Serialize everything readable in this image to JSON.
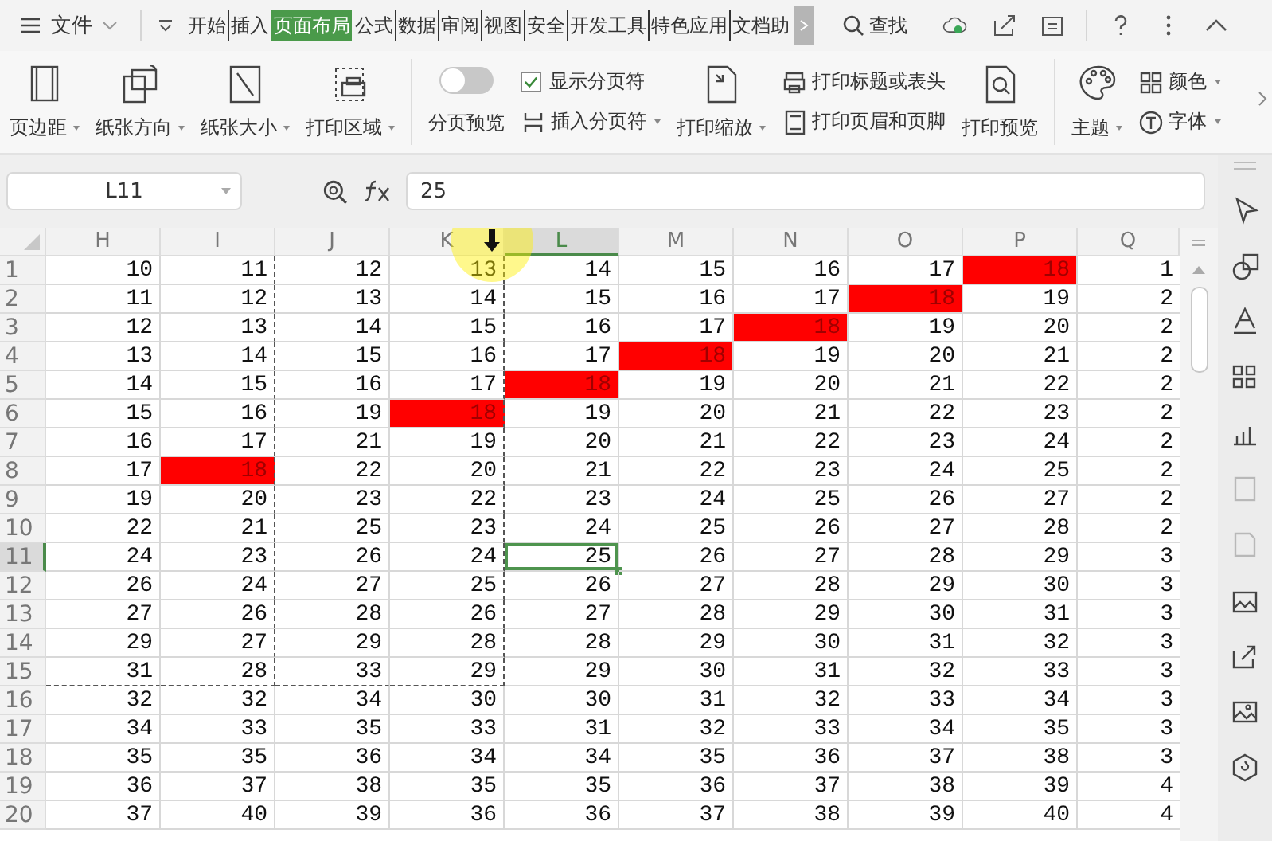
{
  "menu": {
    "file_label": "文件"
  },
  "tabs": [
    {
      "label": "开始",
      "selected": false
    },
    {
      "label": "插入",
      "selected": false
    },
    {
      "label": "页面布局",
      "selected": true
    },
    {
      "label": "公式",
      "selected": false
    },
    {
      "label": "数据",
      "selected": false
    },
    {
      "label": "审阅",
      "selected": false
    },
    {
      "label": "视图",
      "selected": false
    },
    {
      "label": "安全",
      "selected": false
    },
    {
      "label": "开发工具",
      "selected": false
    },
    {
      "label": "特色应用",
      "selected": false
    },
    {
      "label": "文档助",
      "selected": false
    }
  ],
  "search": {
    "label": "查找"
  },
  "ribbon": [
    {
      "kind": "big",
      "label": "页边距",
      "dropdown": true
    },
    {
      "kind": "big",
      "label": "纸张方向",
      "dropdown": true
    },
    {
      "kind": "big",
      "label": "纸张大小",
      "dropdown": true
    },
    {
      "kind": "big",
      "label": "打印区域",
      "dropdown": true
    },
    {
      "kind": "separator"
    },
    {
      "kind": "toggle",
      "label": "分页预览",
      "on": false
    },
    {
      "kind": "stack",
      "items": [
        {
          "kind": "check",
          "label": "显示分页符",
          "checked": true
        },
        {
          "kind": "small",
          "label": "插入分页符",
          "dropdown": true
        }
      ]
    },
    {
      "kind": "big",
      "label": "打印缩放",
      "dropdown": true
    },
    {
      "kind": "stack",
      "items": [
        {
          "kind": "small",
          "label": "打印标题或表头",
          "dropdown": false
        },
        {
          "kind": "small",
          "label": "打印页眉和页脚",
          "dropdown": false
        }
      ]
    },
    {
      "kind": "big",
      "label": "打印预览",
      "dropdown": false
    },
    {
      "kind": "separator"
    },
    {
      "kind": "big",
      "label": "主题",
      "dropdown": true
    },
    {
      "kind": "stack",
      "items": [
        {
          "kind": "small",
          "label": "颜色",
          "dropdown": true
        },
        {
          "kind": "small",
          "label": "字体",
          "dropdown": true
        }
      ]
    }
  ],
  "formula_bar": {
    "name_box": "L11",
    "formula": "25"
  },
  "grid": {
    "columns": [
      {
        "label": "H",
        "selected": false,
        "page_break": false
      },
      {
        "label": "I",
        "selected": false,
        "page_break": true
      },
      {
        "label": "J",
        "selected": false,
        "page_break": false
      },
      {
        "label": "K",
        "selected": false,
        "page_break": true
      },
      {
        "label": "L",
        "selected": true,
        "page_break": false
      },
      {
        "label": "M",
        "selected": false,
        "page_break": false
      },
      {
        "label": "N",
        "selected": false,
        "page_break": false
      },
      {
        "label": "O",
        "selected": false,
        "page_break": false
      },
      {
        "label": "P",
        "selected": false,
        "page_break": false
      },
      {
        "label": "Q",
        "selected": false,
        "page_break": false
      }
    ],
    "rows": [
      {
        "label": "1",
        "selected": false,
        "page_break": false,
        "cells": [
          {
            "value": "10",
            "highlighted": false,
            "selected": false
          },
          {
            "value": "11",
            "highlighted": false,
            "selected": false
          },
          {
            "value": "12",
            "highlighted": false,
            "selected": false
          },
          {
            "value": "13",
            "highlighted": false,
            "selected": false
          },
          {
            "value": "14",
            "highlighted": false,
            "selected": false
          },
          {
            "value": "15",
            "highlighted": false,
            "selected": false
          },
          {
            "value": "16",
            "highlighted": false,
            "selected": false
          },
          {
            "value": "17",
            "highlighted": false,
            "selected": false
          },
          {
            "value": "18",
            "highlighted": true,
            "selected": false
          },
          {
            "value": "1",
            "highlighted": false,
            "selected": false
          }
        ]
      },
      {
        "label": "2",
        "selected": false,
        "page_break": false,
        "cells": [
          {
            "value": "11",
            "highlighted": false,
            "selected": false
          },
          {
            "value": "12",
            "highlighted": false,
            "selected": false
          },
          {
            "value": "13",
            "highlighted": false,
            "selected": false
          },
          {
            "value": "14",
            "highlighted": false,
            "selected": false
          },
          {
            "value": "15",
            "highlighted": false,
            "selected": false
          },
          {
            "value": "16",
            "highlighted": false,
            "selected": false
          },
          {
            "value": "17",
            "highlighted": false,
            "selected": false
          },
          {
            "value": "18",
            "highlighted": true,
            "selected": false
          },
          {
            "value": "19",
            "highlighted": false,
            "selected": false
          },
          {
            "value": "2",
            "highlighted": false,
            "selected": false
          }
        ]
      },
      {
        "label": "3",
        "selected": false,
        "page_break": false,
        "cells": [
          {
            "value": "12",
            "highlighted": false,
            "selected": false
          },
          {
            "value": "13",
            "highlighted": false,
            "selected": false
          },
          {
            "value": "14",
            "highlighted": false,
            "selected": false
          },
          {
            "value": "15",
            "highlighted": false,
            "selected": false
          },
          {
            "value": "16",
            "highlighted": false,
            "selected": false
          },
          {
            "value": "17",
            "highlighted": false,
            "selected": false
          },
          {
            "value": "18",
            "highlighted": true,
            "selected": false
          },
          {
            "value": "19",
            "highlighted": false,
            "selected": false
          },
          {
            "value": "20",
            "highlighted": false,
            "selected": false
          },
          {
            "value": "2",
            "highlighted": false,
            "selected": false
          }
        ]
      },
      {
        "label": "4",
        "selected": false,
        "page_break": false,
        "cells": [
          {
            "value": "13",
            "highlighted": false,
            "selected": false
          },
          {
            "value": "14",
            "highlighted": false,
            "selected": false
          },
          {
            "value": "15",
            "highlighted": false,
            "selected": false
          },
          {
            "value": "16",
            "highlighted": false,
            "selected": false
          },
          {
            "value": "17",
            "highlighted": false,
            "selected": false
          },
          {
            "value": "18",
            "highlighted": true,
            "selected": false
          },
          {
            "value": "19",
            "highlighted": false,
            "selected": false
          },
          {
            "value": "20",
            "highlighted": false,
            "selected": false
          },
          {
            "value": "21",
            "highlighted": false,
            "selected": false
          },
          {
            "value": "2",
            "highlighted": false,
            "selected": false
          }
        ]
      },
      {
        "label": "5",
        "selected": false,
        "page_break": false,
        "cells": [
          {
            "value": "14",
            "highlighted": false,
            "selected": false
          },
          {
            "value": "15",
            "highlighted": false,
            "selected": false
          },
          {
            "value": "16",
            "highlighted": false,
            "selected": false
          },
          {
            "value": "17",
            "highlighted": false,
            "selected": false
          },
          {
            "value": "18",
            "highlighted": true,
            "selected": false
          },
          {
            "value": "19",
            "highlighted": false,
            "selected": false
          },
          {
            "value": "20",
            "highlighted": false,
            "selected": false
          },
          {
            "value": "21",
            "highlighted": false,
            "selected": false
          },
          {
            "value": "22",
            "highlighted": false,
            "selected": false
          },
          {
            "value": "2",
            "highlighted": false,
            "selected": false
          }
        ]
      },
      {
        "label": "6",
        "selected": false,
        "page_break": false,
        "cells": [
          {
            "value": "15",
            "highlighted": false,
            "selected": false
          },
          {
            "value": "16",
            "highlighted": false,
            "selected": false
          },
          {
            "value": "19",
            "highlighted": false,
            "selected": false
          },
          {
            "value": "18",
            "highlighted": true,
            "selected": false
          },
          {
            "value": "19",
            "highlighted": false,
            "selected": false
          },
          {
            "value": "20",
            "highlighted": false,
            "selected": false
          },
          {
            "value": "21",
            "highlighted": false,
            "selected": false
          },
          {
            "value": "22",
            "highlighted": false,
            "selected": false
          },
          {
            "value": "23",
            "highlighted": false,
            "selected": false
          },
          {
            "value": "2",
            "highlighted": false,
            "selected": false
          }
        ]
      },
      {
        "label": "7",
        "selected": false,
        "page_break": false,
        "cells": [
          {
            "value": "16",
            "highlighted": false,
            "selected": false
          },
          {
            "value": "17",
            "highlighted": false,
            "selected": false
          },
          {
            "value": "21",
            "highlighted": false,
            "selected": false
          },
          {
            "value": "19",
            "highlighted": false,
            "selected": false
          },
          {
            "value": "20",
            "highlighted": false,
            "selected": false
          },
          {
            "value": "21",
            "highlighted": false,
            "selected": false
          },
          {
            "value": "22",
            "highlighted": false,
            "selected": false
          },
          {
            "value": "23",
            "highlighted": false,
            "selected": false
          },
          {
            "value": "24",
            "highlighted": false,
            "selected": false
          },
          {
            "value": "2",
            "highlighted": false,
            "selected": false
          }
        ]
      },
      {
        "label": "8",
        "selected": false,
        "page_break": false,
        "cells": [
          {
            "value": "17",
            "highlighted": false,
            "selected": false
          },
          {
            "value": "18",
            "highlighted": true,
            "selected": false
          },
          {
            "value": "22",
            "highlighted": false,
            "selected": false
          },
          {
            "value": "20",
            "highlighted": false,
            "selected": false
          },
          {
            "value": "21",
            "highlighted": false,
            "selected": false
          },
          {
            "value": "22",
            "highlighted": false,
            "selected": false
          },
          {
            "value": "23",
            "highlighted": false,
            "selected": false
          },
          {
            "value": "24",
            "highlighted": false,
            "selected": false
          },
          {
            "value": "25",
            "highlighted": false,
            "selected": false
          },
          {
            "value": "2",
            "highlighted": false,
            "selected": false
          }
        ]
      },
      {
        "label": "9",
        "selected": false,
        "page_break": false,
        "cells": [
          {
            "value": "19",
            "highlighted": false,
            "selected": false
          },
          {
            "value": "20",
            "highlighted": false,
            "selected": false
          },
          {
            "value": "23",
            "highlighted": false,
            "selected": false
          },
          {
            "value": "22",
            "highlighted": false,
            "selected": false
          },
          {
            "value": "23",
            "highlighted": false,
            "selected": false
          },
          {
            "value": "24",
            "highlighted": false,
            "selected": false
          },
          {
            "value": "25",
            "highlighted": false,
            "selected": false
          },
          {
            "value": "26",
            "highlighted": false,
            "selected": false
          },
          {
            "value": "27",
            "highlighted": false,
            "selected": false
          },
          {
            "value": "2",
            "highlighted": false,
            "selected": false
          }
        ]
      },
      {
        "label": "10",
        "selected": false,
        "page_break": false,
        "cells": [
          {
            "value": "22",
            "highlighted": false,
            "selected": false
          },
          {
            "value": "21",
            "highlighted": false,
            "selected": false
          },
          {
            "value": "25",
            "highlighted": false,
            "selected": false
          },
          {
            "value": "23",
            "highlighted": false,
            "selected": false
          },
          {
            "value": "24",
            "highlighted": false,
            "selected": false
          },
          {
            "value": "25",
            "highlighted": false,
            "selected": false
          },
          {
            "value": "26",
            "highlighted": false,
            "selected": false
          },
          {
            "value": "27",
            "highlighted": false,
            "selected": false
          },
          {
            "value": "28",
            "highlighted": false,
            "selected": false
          },
          {
            "value": "2",
            "highlighted": false,
            "selected": false
          }
        ]
      },
      {
        "label": "11",
        "selected": true,
        "page_break": false,
        "cells": [
          {
            "value": "24",
            "highlighted": false,
            "selected": false
          },
          {
            "value": "23",
            "highlighted": false,
            "selected": false
          },
          {
            "value": "26",
            "highlighted": false,
            "selected": false
          },
          {
            "value": "24",
            "highlighted": false,
            "selected": false
          },
          {
            "value": "25",
            "highlighted": false,
            "selected": true
          },
          {
            "value": "26",
            "highlighted": false,
            "selected": false
          },
          {
            "value": "27",
            "highlighted": false,
            "selected": false
          },
          {
            "value": "28",
            "highlighted": false,
            "selected": false
          },
          {
            "value": "29",
            "highlighted": false,
            "selected": false
          },
          {
            "value": "3",
            "highlighted": false,
            "selected": false
          }
        ]
      },
      {
        "label": "12",
        "selected": false,
        "page_break": false,
        "cells": [
          {
            "value": "26",
            "highlighted": false,
            "selected": false
          },
          {
            "value": "24",
            "highlighted": false,
            "selected": false
          },
          {
            "value": "27",
            "highlighted": false,
            "selected": false
          },
          {
            "value": "25",
            "highlighted": false,
            "selected": false
          },
          {
            "value": "26",
            "highlighted": false,
            "selected": false
          },
          {
            "value": "27",
            "highlighted": false,
            "selected": false
          },
          {
            "value": "28",
            "highlighted": false,
            "selected": false
          },
          {
            "value": "29",
            "highlighted": false,
            "selected": false
          },
          {
            "value": "30",
            "highlighted": false,
            "selected": false
          },
          {
            "value": "3",
            "highlighted": false,
            "selected": false
          }
        ]
      },
      {
        "label": "13",
        "selected": false,
        "page_break": false,
        "cells": [
          {
            "value": "27",
            "highlighted": false,
            "selected": false
          },
          {
            "value": "26",
            "highlighted": false,
            "selected": false
          },
          {
            "value": "28",
            "highlighted": false,
            "selected": false
          },
          {
            "value": "26",
            "highlighted": false,
            "selected": false
          },
          {
            "value": "27",
            "highlighted": false,
            "selected": false
          },
          {
            "value": "28",
            "highlighted": false,
            "selected": false
          },
          {
            "value": "29",
            "highlighted": false,
            "selected": false
          },
          {
            "value": "30",
            "highlighted": false,
            "selected": false
          },
          {
            "value": "31",
            "highlighted": false,
            "selected": false
          },
          {
            "value": "3",
            "highlighted": false,
            "selected": false
          }
        ]
      },
      {
        "label": "14",
        "selected": false,
        "page_break": false,
        "cells": [
          {
            "value": "29",
            "highlighted": false,
            "selected": false
          },
          {
            "value": "27",
            "highlighted": false,
            "selected": false
          },
          {
            "value": "29",
            "highlighted": false,
            "selected": false
          },
          {
            "value": "28",
            "highlighted": false,
            "selected": false
          },
          {
            "value": "28",
            "highlighted": false,
            "selected": false
          },
          {
            "value": "29",
            "highlighted": false,
            "selected": false
          },
          {
            "value": "30",
            "highlighted": false,
            "selected": false
          },
          {
            "value": "31",
            "highlighted": false,
            "selected": false
          },
          {
            "value": "32",
            "highlighted": false,
            "selected": false
          },
          {
            "value": "3",
            "highlighted": false,
            "selected": false
          }
        ]
      },
      {
        "label": "15",
        "selected": false,
        "page_break": true,
        "cells": [
          {
            "value": "31",
            "highlighted": false,
            "selected": false
          },
          {
            "value": "28",
            "highlighted": false,
            "selected": false
          },
          {
            "value": "33",
            "highlighted": false,
            "selected": false
          },
          {
            "value": "29",
            "highlighted": false,
            "selected": false
          },
          {
            "value": "29",
            "highlighted": false,
            "selected": false
          },
          {
            "value": "30",
            "highlighted": false,
            "selected": false
          },
          {
            "value": "31",
            "highlighted": false,
            "selected": false
          },
          {
            "value": "32",
            "highlighted": false,
            "selected": false
          },
          {
            "value": "33",
            "highlighted": false,
            "selected": false
          },
          {
            "value": "3",
            "highlighted": false,
            "selected": false
          }
        ]
      },
      {
        "label": "16",
        "selected": false,
        "page_break": false,
        "cells": [
          {
            "value": "32",
            "highlighted": false,
            "selected": false
          },
          {
            "value": "32",
            "highlighted": false,
            "selected": false
          },
          {
            "value": "34",
            "highlighted": false,
            "selected": false
          },
          {
            "value": "30",
            "highlighted": false,
            "selected": false
          },
          {
            "value": "30",
            "highlighted": false,
            "selected": false
          },
          {
            "value": "31",
            "highlighted": false,
            "selected": false
          },
          {
            "value": "32",
            "highlighted": false,
            "selected": false
          },
          {
            "value": "33",
            "highlighted": false,
            "selected": false
          },
          {
            "value": "34",
            "highlighted": false,
            "selected": false
          },
          {
            "value": "3",
            "highlighted": false,
            "selected": false
          }
        ]
      },
      {
        "label": "17",
        "selected": false,
        "page_break": false,
        "cells": [
          {
            "value": "34",
            "highlighted": false,
            "selected": false
          },
          {
            "value": "33",
            "highlighted": false,
            "selected": false
          },
          {
            "value": "35",
            "highlighted": false,
            "selected": false
          },
          {
            "value": "33",
            "highlighted": false,
            "selected": false
          },
          {
            "value": "31",
            "highlighted": false,
            "selected": false
          },
          {
            "value": "32",
            "highlighted": false,
            "selected": false
          },
          {
            "value": "33",
            "highlighted": false,
            "selected": false
          },
          {
            "value": "34",
            "highlighted": false,
            "selected": false
          },
          {
            "value": "35",
            "highlighted": false,
            "selected": false
          },
          {
            "value": "3",
            "highlighted": false,
            "selected": false
          }
        ]
      },
      {
        "label": "18",
        "selected": false,
        "page_break": false,
        "cells": [
          {
            "value": "35",
            "highlighted": false,
            "selected": false
          },
          {
            "value": "35",
            "highlighted": false,
            "selected": false
          },
          {
            "value": "36",
            "highlighted": false,
            "selected": false
          },
          {
            "value": "34",
            "highlighted": false,
            "selected": false
          },
          {
            "value": "34",
            "highlighted": false,
            "selected": false
          },
          {
            "value": "35",
            "highlighted": false,
            "selected": false
          },
          {
            "value": "36",
            "highlighted": false,
            "selected": false
          },
          {
            "value": "37",
            "highlighted": false,
            "selected": false
          },
          {
            "value": "38",
            "highlighted": false,
            "selected": false
          },
          {
            "value": "3",
            "highlighted": false,
            "selected": false
          }
        ]
      },
      {
        "label": "19",
        "selected": false,
        "page_break": false,
        "cells": [
          {
            "value": "36",
            "highlighted": false,
            "selected": false
          },
          {
            "value": "37",
            "highlighted": false,
            "selected": false
          },
          {
            "value": "38",
            "highlighted": false,
            "selected": false
          },
          {
            "value": "35",
            "highlighted": false,
            "selected": false
          },
          {
            "value": "35",
            "highlighted": false,
            "selected": false
          },
          {
            "value": "36",
            "highlighted": false,
            "selected": false
          },
          {
            "value": "37",
            "highlighted": false,
            "selected": false
          },
          {
            "value": "38",
            "highlighted": false,
            "selected": false
          },
          {
            "value": "39",
            "highlighted": false,
            "selected": false
          },
          {
            "value": "4",
            "highlighted": false,
            "selected": false
          }
        ]
      },
      {
        "label": "20",
        "selected": false,
        "page_break": false,
        "cells": [
          {
            "value": "37",
            "highlighted": false,
            "selected": false
          },
          {
            "value": "40",
            "highlighted": false,
            "selected": false
          },
          {
            "value": "39",
            "highlighted": false,
            "selected": false
          },
          {
            "value": "36",
            "highlighted": false,
            "selected": false
          },
          {
            "value": "36",
            "highlighted": false,
            "selected": false
          },
          {
            "value": "37",
            "highlighted": false,
            "selected": false
          },
          {
            "value": "38",
            "highlighted": false,
            "selected": false
          },
          {
            "value": "39",
            "highlighted": false,
            "selected": false
          },
          {
            "value": "40",
            "highlighted": false,
            "selected": false
          },
          {
            "value": "4",
            "highlighted": false,
            "selected": false
          }
        ]
      }
    ]
  },
  "sidebar_tools": [
    {
      "disabled": false
    },
    {
      "disabled": false
    },
    {
      "disabled": false
    },
    {
      "disabled": false
    },
    {
      "disabled": false
    },
    {
      "disabled": true
    },
    {
      "disabled": true
    },
    {
      "disabled": false
    },
    {
      "disabled": false
    },
    {
      "disabled": false
    },
    {
      "disabled": false
    }
  ]
}
